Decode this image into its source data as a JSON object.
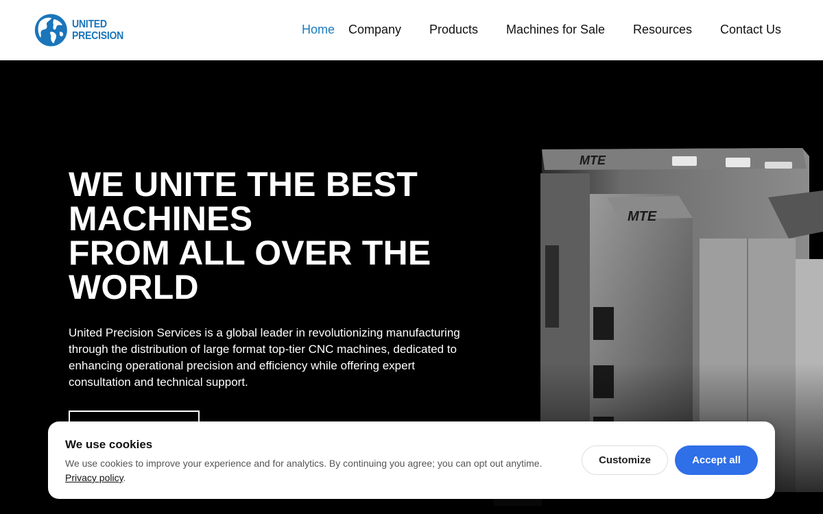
{
  "brand": {
    "line1": "UNITED",
    "line2": "PRECISION",
    "color": "#1a75bb"
  },
  "nav": {
    "items": [
      {
        "label": "Home",
        "active": true
      },
      {
        "label": "Company"
      },
      {
        "label": "Products"
      },
      {
        "label": "Machines for Sale"
      },
      {
        "label": "Resources"
      },
      {
        "label": "Contact Us"
      }
    ],
    "active_color": "#1a7bc0"
  },
  "hero": {
    "title_lines": [
      "WE UNITE THE BEST",
      "MACHINES",
      "FROM ALL OVER THE",
      "WORLD"
    ],
    "description": "United Precision Services is a global leader in revolutionizing manufacturing through the distribution of large format top-tier CNC machines, dedicated to enhancing operational precision and efficiency while offering expert consultation and technical support.",
    "machine_brand": "MTE"
  },
  "cookie": {
    "title": "We use cookies",
    "text": "We use cookies to improve your experience and for analytics. By continuing you agree; you can opt out anytime.",
    "link_label": "Privacy policy",
    "link_suffix": ".",
    "customize_label": "Customize",
    "accept_label": "Accept all",
    "accept_color": "#2f6fe8"
  }
}
